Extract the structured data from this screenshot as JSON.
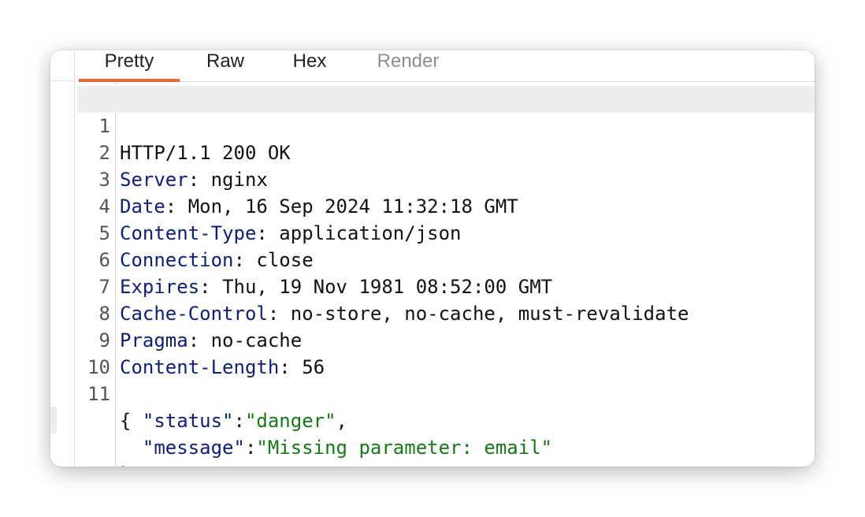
{
  "tabs": [
    {
      "label": "Pretty"
    },
    {
      "label": "Raw"
    },
    {
      "label": "Hex"
    },
    {
      "label": "Render"
    }
  ],
  "response": {
    "status_line": "HTTP/1.1 200 OK",
    "headers": [
      {
        "name": "Server",
        "value": "nginx"
      },
      {
        "name": "Date",
        "value": "Mon, 16 Sep 2024 11:32:18 GMT"
      },
      {
        "name": "Content-Type",
        "value": "application/json"
      },
      {
        "name": "Connection",
        "value": "close"
      },
      {
        "name": "Expires",
        "value": "Thu, 19 Nov 1981 08:52:00 GMT"
      },
      {
        "name": "Cache-Control",
        "value": "no-store, no-cache, must-revalidate"
      },
      {
        "name": "Pragma",
        "value": "no-cache"
      },
      {
        "name": "Content-Length",
        "value": "56"
      }
    ],
    "body": {
      "open_brace": "{",
      "close_brace": "}",
      "fields": [
        {
          "key": "\"status\"",
          "value": "\"danger\"",
          "trail": ","
        },
        {
          "key": "\"message\"",
          "value": "\"Missing parameter: email\"",
          "trail": ""
        }
      ]
    }
  },
  "line_numbers": [
    "1",
    "2",
    "3",
    "4",
    "5",
    "6",
    "7",
    "8",
    "9",
    "10",
    "11"
  ],
  "punct": {
    "colon_space": ": ",
    "colon": ":"
  }
}
